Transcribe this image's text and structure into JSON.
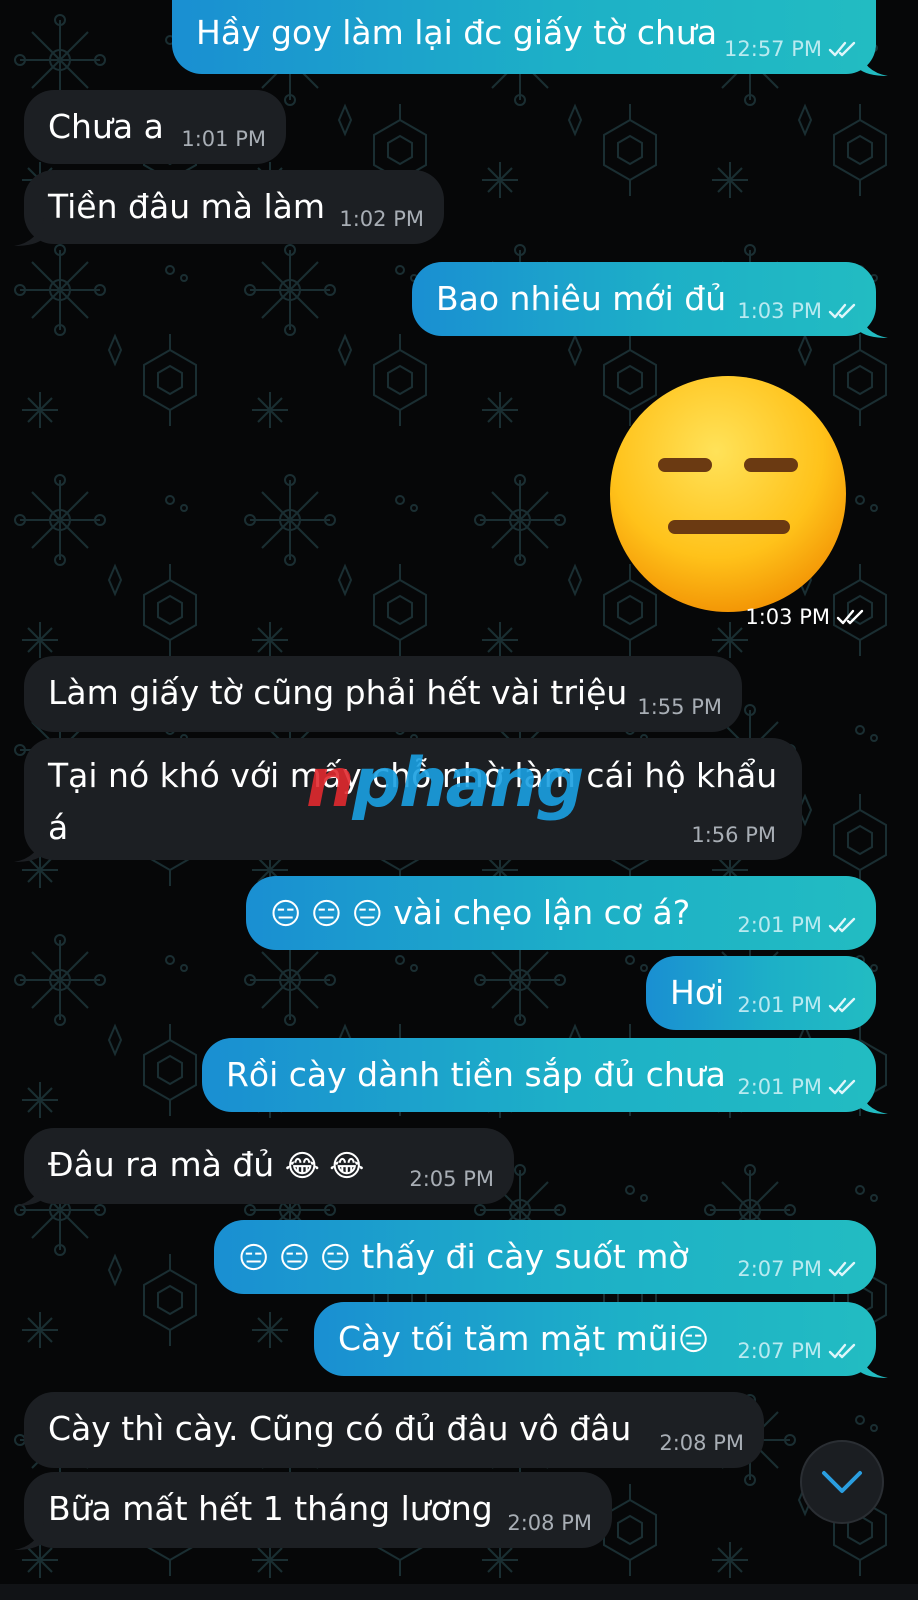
{
  "theme": {
    "incoming_bubble": "#1c1f23",
    "outgoing_bubble_start": "#1a8fd2",
    "outgoing_bubble_end": "#22bcc2",
    "background": "#060708"
  },
  "messages": [
    {
      "direction": "out",
      "text": "Hầy goy làm lại đc giấy tờ chưa",
      "time": "12:57 PM",
      "status": "read"
    },
    {
      "direction": "in",
      "text": "Chưa a",
      "time": "1:01 PM"
    },
    {
      "direction": "in",
      "text": "Tiền đâu mà làm",
      "time": "1:02 PM"
    },
    {
      "direction": "out",
      "text": "Bao nhiêu mới đủ",
      "time": "1:03 PM",
      "status": "read"
    },
    {
      "direction": "out",
      "type": "sticker",
      "sticker": "expressionless-face-icon",
      "time": "1:03 PM",
      "status": "read"
    },
    {
      "direction": "in",
      "text": "Làm giấy tờ cũng phải hết vài triệu",
      "time": "1:55 PM"
    },
    {
      "direction": "in",
      "text": "Tại nó khó với mấy chỗ nhờ làm cái hộ khẩu á",
      "time": "1:56 PM"
    },
    {
      "direction": "out",
      "emoji": "😑 😑 😑",
      "text": "vài chẹo lận cơ á?",
      "time": "2:01 PM",
      "status": "read"
    },
    {
      "direction": "out",
      "text": "Hơi",
      "time": "2:01 PM",
      "status": "read"
    },
    {
      "direction": "out",
      "text": "Rồi cày dành tiền sắp đủ chưa",
      "time": "2:01 PM",
      "status": "read"
    },
    {
      "direction": "in",
      "text": "Đâu ra mà đủ",
      "emoji_after": "😂 😂",
      "time": "2:05 PM"
    },
    {
      "direction": "out",
      "emoji": "😑 😑 😑",
      "text": "thấy đi cày suốt mờ",
      "time": "2:07 PM",
      "status": "read"
    },
    {
      "direction": "out",
      "text": "Cày tối tăm mặt mũi",
      "emoji_after": "😑",
      "time": "2:07 PM",
      "status": "read"
    },
    {
      "direction": "in",
      "text": "Cày thì cày. Cũng có đủ đâu vô đâu",
      "time": "2:08 PM"
    },
    {
      "direction": "in",
      "text": "Bữa mất hết 1 tháng lương",
      "time": "2:08 PM"
    }
  ],
  "watermark": {
    "part1": "n",
    "part2": "phang"
  },
  "scroll_down_button": {
    "icon": "chevron-down-icon"
  }
}
